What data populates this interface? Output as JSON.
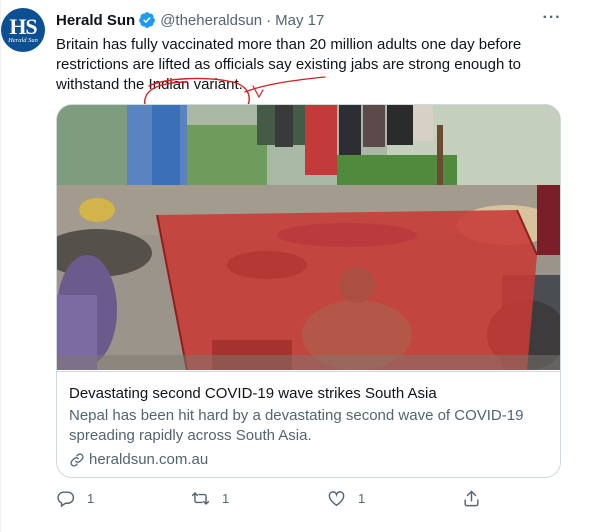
{
  "tweet": {
    "author_name": "Herald Sun",
    "handle": "@theheraldsun",
    "separator": "·",
    "date": "May 17",
    "more_label": "···",
    "text": "Britain has fully vaccinated more than 20 million adults one day before restrictions are lifted as officials say existing jabs are strong enough to withstand the Indian variant."
  },
  "avatar": {
    "monogram": "HS",
    "subtitle": "Herald Sun",
    "color": "#0d4f93"
  },
  "card": {
    "title": "Devastating second COVID-19 wave strikes South Asia",
    "description": "Nepal has been hit hard by a devastating second wave of COVID-19 spreading rapidly across South Asia.",
    "domain": "heraldsun.com.au"
  },
  "actions": {
    "reply_count": "1",
    "retweet_count": "1",
    "like_count": "1"
  },
  "colors": {
    "verified_blue": "#1d9bf0",
    "secondary_text": "#536471",
    "annotation_red": "#d42020"
  },
  "icons": [
    "verified-icon",
    "more-icon",
    "link-icon",
    "reply-icon",
    "retweet-icon",
    "like-icon",
    "share-icon"
  ]
}
